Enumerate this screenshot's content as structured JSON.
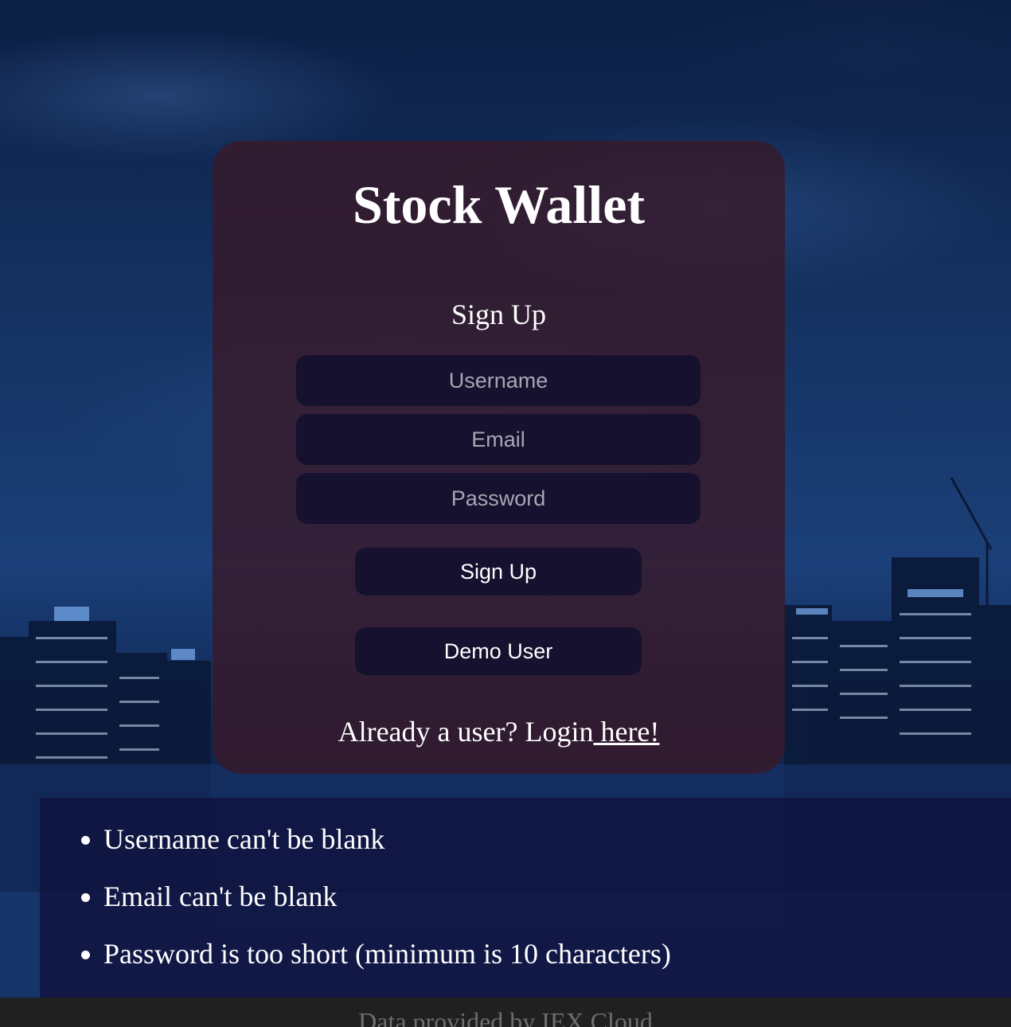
{
  "app": {
    "title": "Stock Wallet"
  },
  "signup_form": {
    "heading": "Sign Up",
    "username_placeholder": "Username",
    "email_placeholder": "Email",
    "password_placeholder": "Password",
    "submit_label": "Sign Up",
    "demo_label": "Demo User",
    "login_prompt": "Already a user? Login",
    "login_link": " here!"
  },
  "errors": [
    "Username can't be blank",
    "Email can't be blank",
    "Password is too short (minimum is 10 characters)"
  ],
  "footer": {
    "text": "Data provided by IEX Cloud"
  },
  "colors": {
    "card_bg": "#3a1826",
    "field_bg": "#15112e",
    "error_bg": "#10123e",
    "footer_bg": "#202020"
  }
}
